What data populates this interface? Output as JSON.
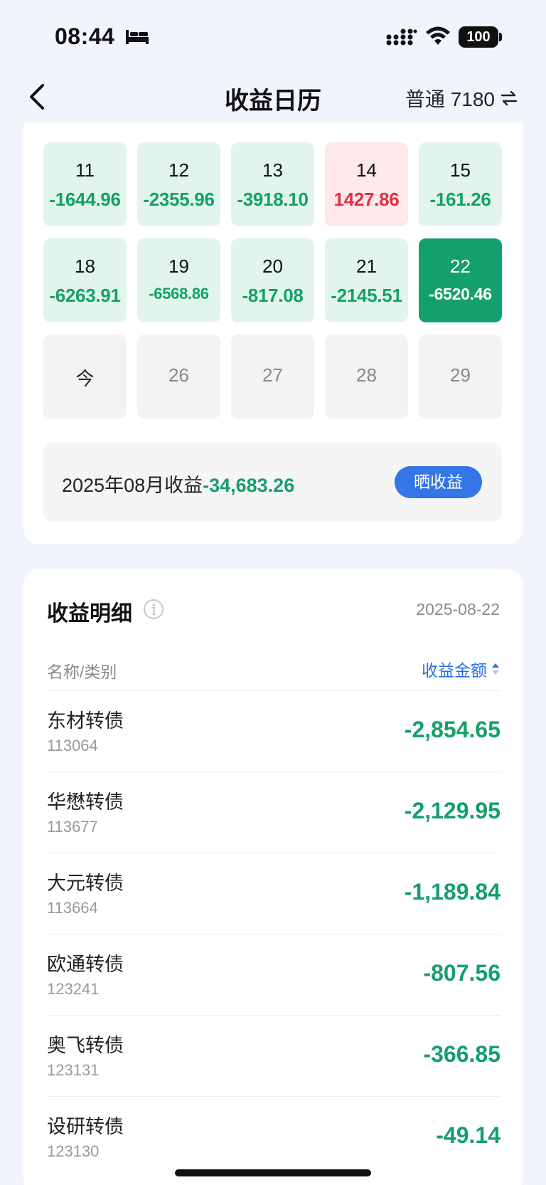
{
  "status_bar": {
    "time": "08:44",
    "battery": "100"
  },
  "nav": {
    "title": "收益日历",
    "account": "普通 7180"
  },
  "calendar": {
    "weeks": [
      [
        {
          "day": "11",
          "value": "-1644.96",
          "tone": "green"
        },
        {
          "day": "12",
          "value": "-2355.96",
          "tone": "green"
        },
        {
          "day": "13",
          "value": "-3918.10",
          "tone": "green"
        },
        {
          "day": "14",
          "value": "1427.86",
          "tone": "red"
        },
        {
          "day": "15",
          "value": "-161.26",
          "tone": "green"
        }
      ],
      [
        {
          "day": "18",
          "value": "-6263.91",
          "tone": "green"
        },
        {
          "day": "19",
          "value": "-6568.86",
          "tone": "green"
        },
        {
          "day": "20",
          "value": "-817.08",
          "tone": "green"
        },
        {
          "day": "21",
          "value": "-2145.51",
          "tone": "green"
        },
        {
          "day": "22",
          "value": "-6520.46",
          "tone": "selected"
        }
      ],
      [
        {
          "day": "今",
          "value": "",
          "tone": "grey"
        },
        {
          "day": "26",
          "value": "",
          "tone": "grey"
        },
        {
          "day": "27",
          "value": "",
          "tone": "grey"
        },
        {
          "day": "28",
          "value": "",
          "tone": "grey"
        },
        {
          "day": "29",
          "value": "",
          "tone": "grey"
        }
      ]
    ],
    "top_row_tones": [
      "green",
      "green",
      "red",
      "green",
      "red"
    ]
  },
  "month_summary": {
    "label": "2025年08月收益",
    "value": "-34,683.26",
    "share_button": "晒收益"
  },
  "detail": {
    "title": "收益明细",
    "date": "2025-08-22",
    "col_name": "名称/类别",
    "col_amount": "收益金额",
    "rows": [
      {
        "name": "东材转债",
        "code": "113064",
        "amount": "-2,854.65"
      },
      {
        "name": "华懋转债",
        "code": "113677",
        "amount": "-2,129.95"
      },
      {
        "name": "大元转债",
        "code": "113664",
        "amount": "-1,189.84"
      },
      {
        "name": "欧通转债",
        "code": "123241",
        "amount": "-807.56"
      },
      {
        "name": "奥飞转债",
        "code": "123131",
        "amount": "-366.85"
      },
      {
        "name": "设研转债",
        "code": "123130",
        "amount": "-49.14"
      }
    ]
  },
  "colors": {
    "gain": "#e0313f",
    "loss": "#14a06a",
    "accent": "#3476e8",
    "background": "#f1f4fa"
  },
  "icons": [
    "bed-icon",
    "signal-icon",
    "wifi-icon",
    "back-arrow-icon",
    "swap-icon",
    "info-icon",
    "sort-icon"
  ]
}
